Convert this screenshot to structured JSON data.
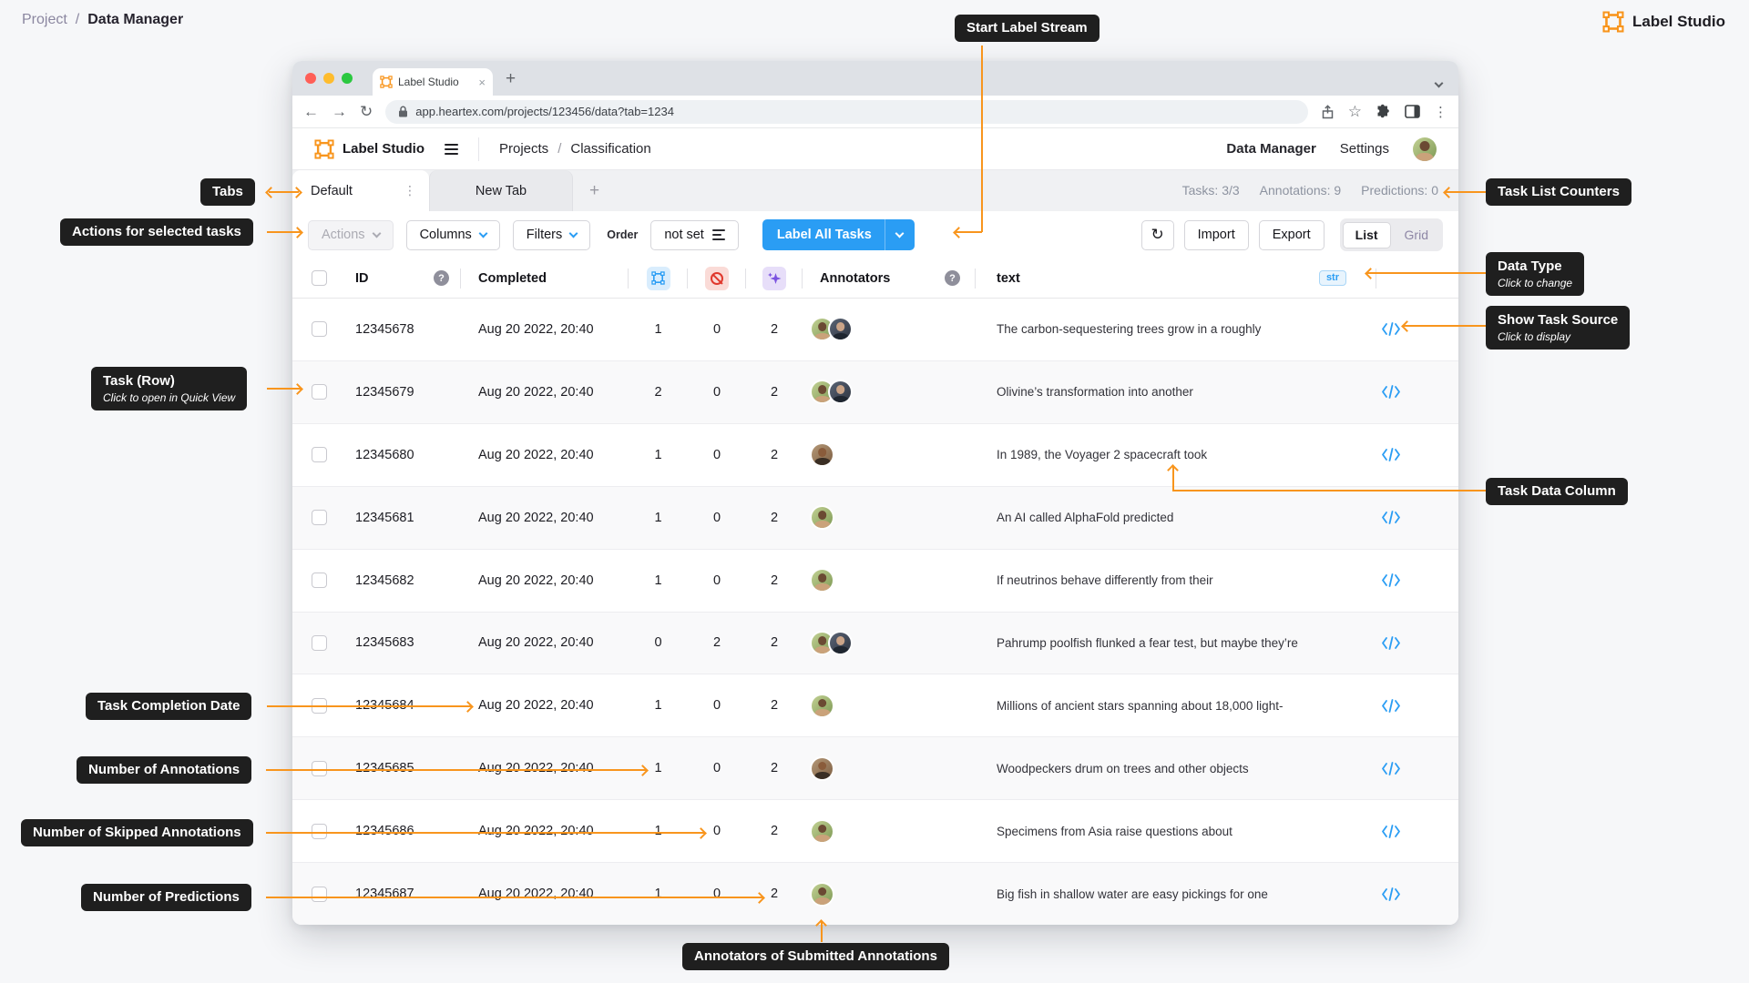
{
  "colors": {
    "accent_orange": "#F8951D",
    "primary_blue": "#2A9DF4",
    "callout_bg": "#1F1F1F",
    "skip_red": "#E0382C",
    "prediction_purple": "#7B52E0"
  },
  "breadcrumb": {
    "project": "Project",
    "sep": "/",
    "current": "Data Manager"
  },
  "brand": {
    "label": "Label Studio"
  },
  "browser": {
    "tab_title": "Label Studio",
    "close": "×",
    "new_tab": "+",
    "back": "←",
    "forward": "→",
    "reload": "↻",
    "star": "☆",
    "menu": "⋮",
    "url": "app.heartex.com/projects/123456/data?tab=1234"
  },
  "header": {
    "brand": "Label Studio",
    "nav_projects": "Projects",
    "nav_sep": "/",
    "nav_project_name": "Classification",
    "menu_data_manager": "Data Manager",
    "menu_settings": "Settings"
  },
  "tabs": {
    "default": "Default",
    "default_menu": "⋮",
    "new_tab": "New Tab",
    "add": "+"
  },
  "counters": {
    "tasks": "Tasks: 3/3",
    "annotations": "Annotations: 9",
    "predictions": "Predictions: 0"
  },
  "toolbar": {
    "actions": "Actions",
    "columns": "Columns",
    "filters": "Filters",
    "order_label": "Order",
    "order_value": "not set",
    "label_all_tasks": "Label All Tasks",
    "refresh": "↻",
    "import": "Import",
    "export": "Export",
    "list": "List",
    "grid": "Grid"
  },
  "table": {
    "h_id": "ID",
    "h_completed": "Completed",
    "h_annotators": "Annotators",
    "h_text": "text",
    "type_badge": "str",
    "rows": [
      {
        "id": "12345678",
        "completed": "Aug 20 2022, 20:40",
        "annotations": "1",
        "skipped": "0",
        "predictions": "2",
        "annotators": [
          "woman",
          "man"
        ],
        "text": "The carbon-sequestering trees grow in a roughly"
      },
      {
        "id": "12345679",
        "completed": "Aug 20 2022, 20:40",
        "annotations": "2",
        "skipped": "0",
        "predictions": "2",
        "annotators": [
          "woman",
          "man"
        ],
        "text": "Olivine’s transformation into another"
      },
      {
        "id": "12345680",
        "completed": "Aug 20 2022, 20:40",
        "annotations": "1",
        "skipped": "0",
        "predictions": "2",
        "annotators": [
          "man2"
        ],
        "text": "In 1989, the Voyager 2 spacecraft took"
      },
      {
        "id": "12345681",
        "completed": "Aug 20 2022, 20:40",
        "annotations": "1",
        "skipped": "0",
        "predictions": "2",
        "annotators": [
          "woman"
        ],
        "text": "An AI called AlphaFold predicted"
      },
      {
        "id": "12345682",
        "completed": "Aug 20 2022, 20:40",
        "annotations": "1",
        "skipped": "0",
        "predictions": "2",
        "annotators": [
          "woman"
        ],
        "text": "If neutrinos behave differently from their"
      },
      {
        "id": "12345683",
        "completed": "Aug 20 2022, 20:40",
        "annotations": "0",
        "skipped": "2",
        "predictions": "2",
        "annotators": [
          "woman",
          "man"
        ],
        "text": "Pahrump poolfish flunked a fear test, but maybe they’re"
      },
      {
        "id": "12345684",
        "completed": "Aug 20 2022, 20:40",
        "annotations": "1",
        "skipped": "0",
        "predictions": "2",
        "annotators": [
          "woman"
        ],
        "text": "Millions of ancient stars spanning about 18,000 light-"
      },
      {
        "id": "12345685",
        "completed": "Aug 20 2022, 20:40",
        "annotations": "1",
        "skipped": "0",
        "predictions": "2",
        "annotators": [
          "man2"
        ],
        "text": "Woodpeckers drum on trees and other objects"
      },
      {
        "id": "12345686",
        "completed": "Aug 20 2022, 20:40",
        "annotations": "1",
        "skipped": "0",
        "predictions": "2",
        "annotators": [
          "woman"
        ],
        "text": "Specimens from Asia raise questions about"
      },
      {
        "id": "12345687",
        "completed": "Aug 20 2022, 20:40",
        "annotations": "1",
        "skipped": "0",
        "predictions": "2",
        "annotators": [
          "woman"
        ],
        "text": "Big fish in shallow water are easy pickings for one"
      }
    ]
  },
  "callouts": {
    "start_label_stream": {
      "title": "Start Label Stream"
    },
    "tabs": {
      "title": "Tabs"
    },
    "actions": {
      "title": "Actions for selected tasks"
    },
    "task_list_counters": {
      "title": "Task List Counters"
    },
    "data_type": {
      "title": "Data Type",
      "subtitle": "Click to change"
    },
    "show_task_source": {
      "title": "Show Task Source",
      "subtitle": "Click to display"
    },
    "task_row": {
      "title": "Task (Row)",
      "subtitle": "Click to open in Quick View"
    },
    "task_data_column": {
      "title": "Task Data Column"
    },
    "task_completion_date": {
      "title": "Task Completion Date"
    },
    "number_of_annotations": {
      "title": "Number of Annotations"
    },
    "number_of_skipped": {
      "title": "Number of Skipped Annotations"
    },
    "number_of_predictions": {
      "title": "Number of Predictions"
    },
    "annotators_submitted": {
      "title": "Annotators of Submitted Annotations"
    }
  }
}
